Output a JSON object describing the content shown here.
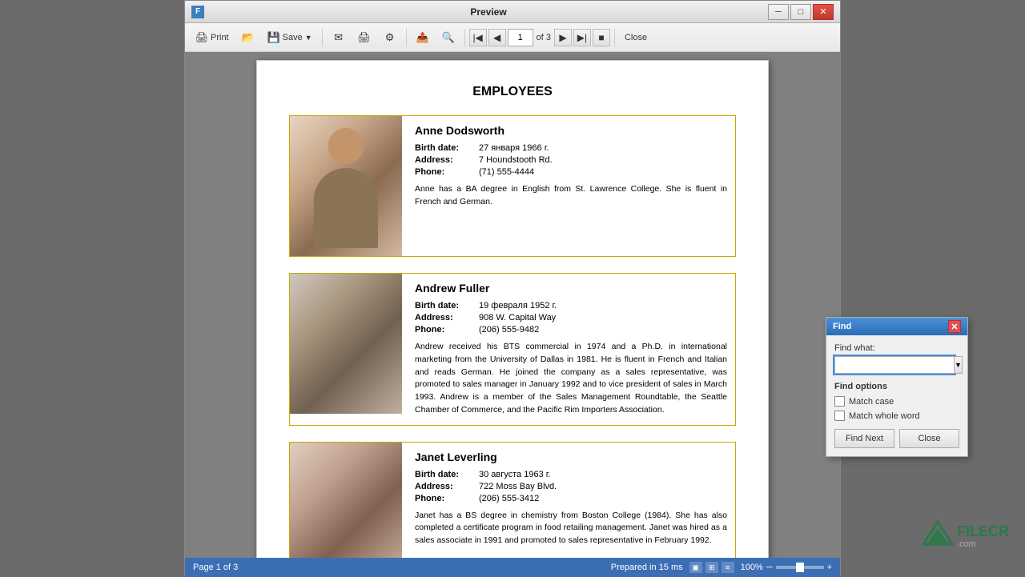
{
  "window": {
    "title": "Preview",
    "icon_label": "F"
  },
  "toolbar": {
    "print_label": "Print",
    "save_label": "Save",
    "close_label": "Close",
    "page_current": "1",
    "page_of": "of 3"
  },
  "document": {
    "title": "EMPLOYEES",
    "employees": [
      {
        "name": "Anne Dodsworth",
        "birth_date_label": "Birth date:",
        "birth_date": "27 января 1966 г.",
        "address_label": "Address:",
        "address": "7 Houndstooth Rd.",
        "phone_label": "Phone:",
        "phone": "(71) 555-4444",
        "bio": "Anne has a BA degree in English from St. Lawrence College. She is fluent in French and German."
      },
      {
        "name": "Andrew Fuller",
        "birth_date_label": "Birth date:",
        "birth_date": "19 февраля 1952 г.",
        "address_label": "Address:",
        "address": "908 W. Capital Way",
        "phone_label": "Phone:",
        "phone": "(206) 555-9482",
        "bio": "Andrew received his BTS commercial in 1974 and a Ph.D. in international marketing from the University of Dallas in 1981. He is fluent in French and Italian and reads German. He joined the company as a sales representative, was promoted to sales manager in January 1992 and to vice president of sales in March 1993. Andrew is a member of the Sales Management Roundtable, the Seattle Chamber of Commerce, and the Pacific Rim Importers Association."
      },
      {
        "name": "Janet Leverling",
        "birth_date_label": "Birth date:",
        "birth_date": "30 августа 1963 г.",
        "address_label": "Address:",
        "address": "722 Moss Bay Blvd.",
        "phone_label": "Phone:",
        "phone": "(206) 555-3412",
        "bio": "Janet has a BS degree in chemistry from Boston College (1984). She has also completed a certificate program in food retailing management. Janet was hired as a sales associate in 1991 and promoted to sales representative in February 1992."
      }
    ]
  },
  "find_dialog": {
    "title": "Find",
    "find_what_label": "Find what:",
    "find_input_value": "",
    "find_options_label": "Find options",
    "match_case_label": "Match case",
    "match_whole_word_label": "Match whole word",
    "find_next_label": "Find Next",
    "close_label": "Close"
  },
  "status_bar": {
    "page_info": "Page 1 of 3",
    "prepared_info": "Prepared in 15 ms",
    "zoom": "100%"
  },
  "watermark": {
    "text": "FILECR",
    "subtext": ".com"
  }
}
